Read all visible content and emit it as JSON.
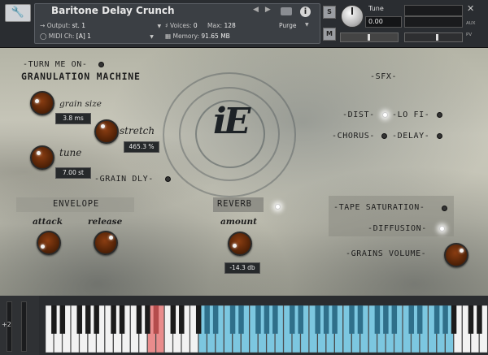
{
  "header": {
    "instrument_name": "Baritone Delay Crunch",
    "output_label": "Output:",
    "output_value": "st. 1",
    "voices_label": "Voices:",
    "voices_value": "0",
    "max_label": "Max:",
    "max_value": "128",
    "purge_label": "Purge",
    "midi_label": "MIDI Ch:",
    "midi_value": "[A] 1",
    "memory_label": "Memory:",
    "memory_value": "91.65 MB",
    "tune_label": "Tune",
    "tune_value": "0.00",
    "solo_label": "S",
    "mute_label": "M",
    "aux_label": "AUX",
    "pv_label": "PV"
  },
  "granulation": {
    "turn_on_label": "-TURN ME ON-",
    "section_title": "GRANULATION MACHINE",
    "grain_size_label": "grain size",
    "grain_size_value": "3.8 ms",
    "stretch_label": "stretch",
    "stretch_value": "465.3 %",
    "tune_label": "tune",
    "tune_value": "7.00 st",
    "grain_delay_label": "-GRAIN DLY-"
  },
  "envelope": {
    "title": "ENVELOPE",
    "attack_label": "attack",
    "release_label": "release"
  },
  "reverb": {
    "title": "REVERB",
    "amount_label": "amount",
    "amount_value": "-14.3 db"
  },
  "sfx": {
    "title": "-SFX-",
    "dist_label": "-DIST-",
    "lofi_label": "-LO FI-",
    "chorus_label": "-CHORUS-",
    "delay_label": "-DELAY-",
    "tape_label": "-TAPE SATURATION-",
    "diffusion_label": "-DIFFUSION-",
    "grains_volume_label": "-GRAINS VOLUME-"
  },
  "logo_text": "iE",
  "keyboard": {
    "octave_shift": "+2",
    "white_key_count": 52,
    "red_keys": [
      12,
      13
    ],
    "blue_range": [
      18,
      47
    ]
  }
}
